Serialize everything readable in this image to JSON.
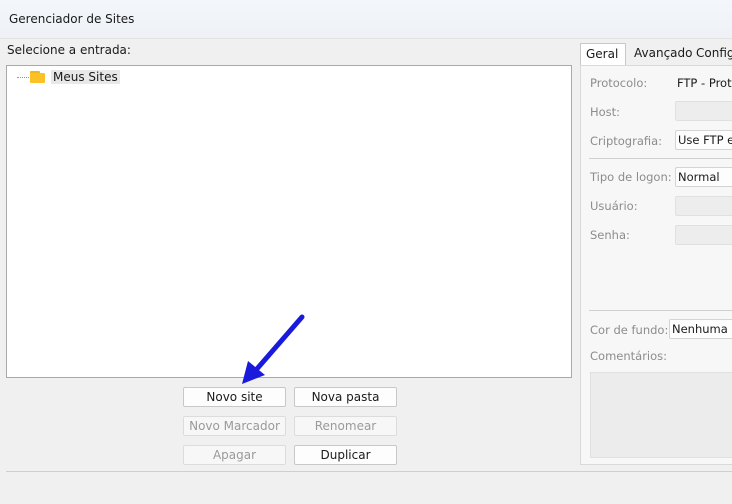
{
  "window": {
    "title": "Gerenciador de Sites"
  },
  "left": {
    "label": "Selecione a entrada:",
    "tree": [
      {
        "label": "Meus Sites",
        "icon": "folder-icon"
      }
    ],
    "buttons": {
      "new_site": "Novo site",
      "new_folder": "Nova pasta",
      "new_bookmark": "Novo Marcador",
      "rename": "Renomear",
      "delete": "Apagar",
      "duplicate": "Duplicar"
    }
  },
  "right": {
    "tabs": [
      "Geral",
      "Avançado",
      "Config"
    ],
    "fields": {
      "protocol_label": "Protocolo:",
      "protocol_value": "FTP - Proto",
      "host_label": "Host:",
      "encryption_label": "Criptografia:",
      "encryption_value": "Use FTP ex",
      "logon_label": "Tipo de logon:",
      "logon_value": "Normal",
      "user_label": "Usuário:",
      "password_label": "Senha:",
      "bgcolor_label": "Cor de fundo:",
      "bgcolor_value": "Nenhuma",
      "comments_label": "Comentários:"
    }
  },
  "annotation": {
    "arrow_color": "#1a1adc"
  }
}
